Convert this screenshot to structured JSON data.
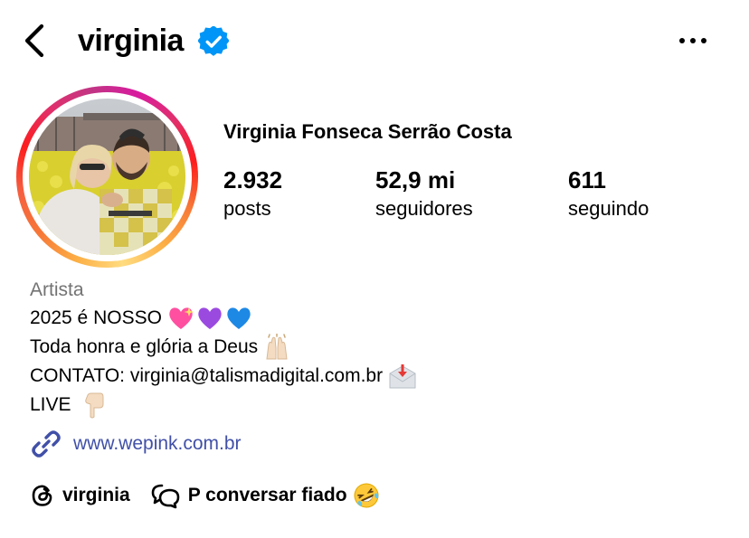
{
  "header": {
    "username": "virginia",
    "verified": true,
    "back_icon": "chevron-left-icon",
    "more_icon": "more-horizontal-icon"
  },
  "profile": {
    "full_name": "Virginia Fonseca Serrão Costa",
    "stats": [
      {
        "value": "2.932",
        "label": "posts"
      },
      {
        "value": "52,9 mi",
        "label": "seguidores"
      },
      {
        "value": "611",
        "label": "seguindo"
      }
    ]
  },
  "bio": {
    "category": "Artista",
    "line1": "2025 é NOSSO",
    "line2": "Toda honra e glória a Deus",
    "line3": "CONTATO: virginia@talismadigital.com.br",
    "line4": "LIVE"
  },
  "link": {
    "icon": "link-icon",
    "text": "www.wepink.com.br"
  },
  "bottom": {
    "threads_icon": "threads-icon",
    "threads_label": "virginia",
    "chat_icon": "chat-bubbles-icon",
    "chat_label": "P conversar fiado"
  },
  "colors": {
    "verified": "#0095f6",
    "link": "#4150a8",
    "muted": "#737373"
  }
}
